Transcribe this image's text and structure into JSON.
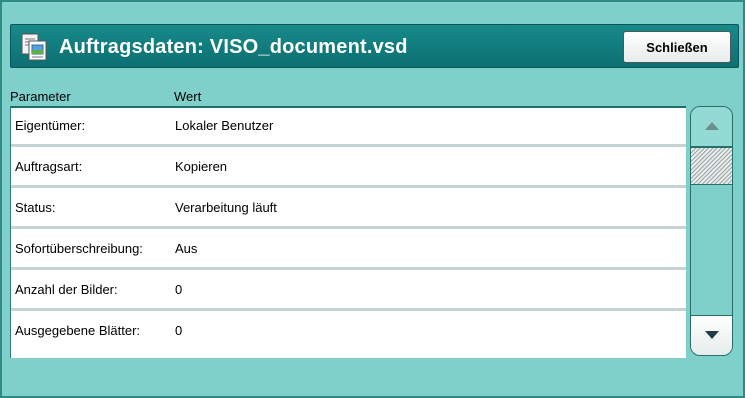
{
  "dialog": {
    "title": "Auftragsdaten: VISO_document.vsd",
    "close_label": "Schließen",
    "icon": "document-icon"
  },
  "table": {
    "headers": {
      "parameter": "Parameter",
      "value": "Wert"
    },
    "rows": [
      {
        "param": "Eigentümer:",
        "value": "Lokaler Benutzer"
      },
      {
        "param": "Auftragsart:",
        "value": "Kopieren"
      },
      {
        "param": "Status:",
        "value": "Verarbeitung läuft"
      },
      {
        "param": "Sofortüberschreibung:",
        "value": "Aus"
      },
      {
        "param": "Anzahl der Bilder:",
        "value": "0"
      },
      {
        "param": "Ausgegebene Blätter:",
        "value": "0"
      }
    ]
  },
  "scrollbar": {
    "up_icon": "triangle-up-icon",
    "down_icon": "triangle-down-icon"
  },
  "colors": {
    "background": "#7fd0cb",
    "header": "#0d6f72",
    "row_separator": "#c7d3d2"
  }
}
